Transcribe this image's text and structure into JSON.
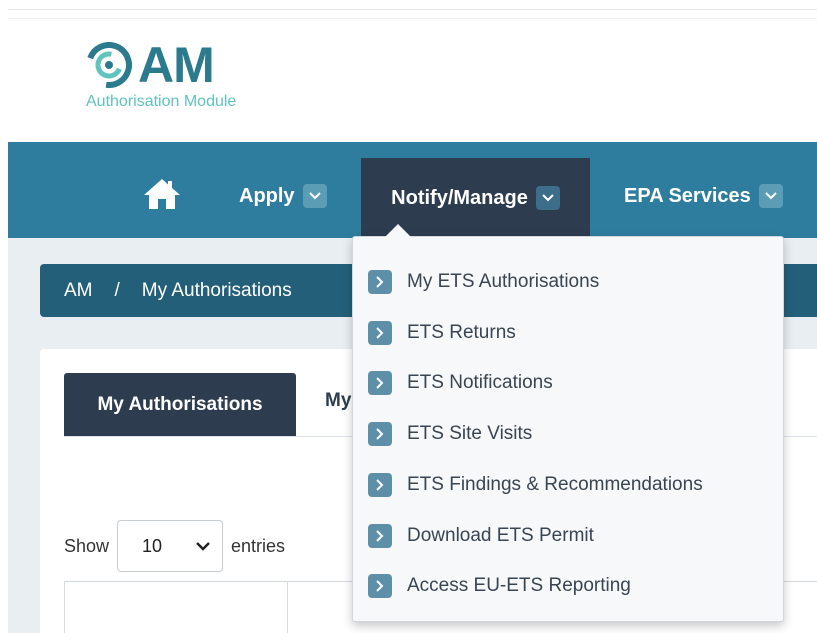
{
  "logo": {
    "title": "AM",
    "subtitle": "Authorisation Module"
  },
  "nav": {
    "home_icon": "home-icon",
    "apply": "Apply",
    "notify_manage": "Notify/Manage",
    "epa_services": "EPA Services"
  },
  "breadcrumb": {
    "root": "AM",
    "separator": "/",
    "current": "My Authorisations"
  },
  "tabs": {
    "active": "My Authorisations",
    "next_partial": "My"
  },
  "table_controls": {
    "show_label": "Show",
    "entries_value": "10",
    "entries_label": "entries"
  },
  "dropdown": {
    "items": [
      "My ETS Authorisations",
      "ETS Returns",
      "ETS Notifications",
      "ETS Site Visits",
      "ETS Findings & Recommendations",
      "Download ETS Permit",
      "Access EU-ETS Reporting"
    ]
  },
  "colors": {
    "nav_bar": "#2f7d9e",
    "nav_active": "#2d3d4f",
    "breadcrumb": "#245f79",
    "logo": "#2b7a8e",
    "logo_sub": "#5fc3be",
    "menu_chevron": "#5e8fa8"
  }
}
